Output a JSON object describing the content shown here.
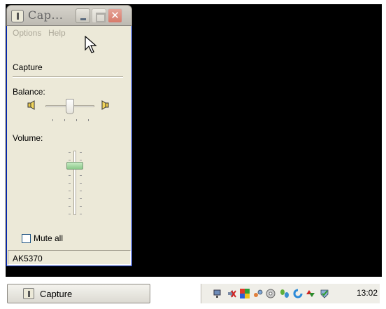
{
  "window": {
    "title": "Cap...",
    "menu": [
      "Options",
      "Help"
    ],
    "device_label": "Capture",
    "balance_label": "Balance:",
    "volume_label": "Volume:",
    "volume_level": 0.8,
    "balance_position": 0.5,
    "mute_label": "Mute all",
    "mute_checked": false,
    "status_text": "AK5370"
  },
  "taskbar": {
    "task_label": "Capture",
    "clock": "13:02",
    "tray_icons": [
      "network-icon",
      "volume-muted-icon",
      "color-blocks-icon",
      "network-share-icon",
      "disc-icon",
      "butterfly-icon",
      "refresh-icon",
      "update-icon",
      "antivirus-icon"
    ]
  },
  "colors": {
    "desktop": "#000000",
    "window_face": "#ECE9D8",
    "close_button": "#D77A6A",
    "volume_thumb": "#8BC98A"
  }
}
